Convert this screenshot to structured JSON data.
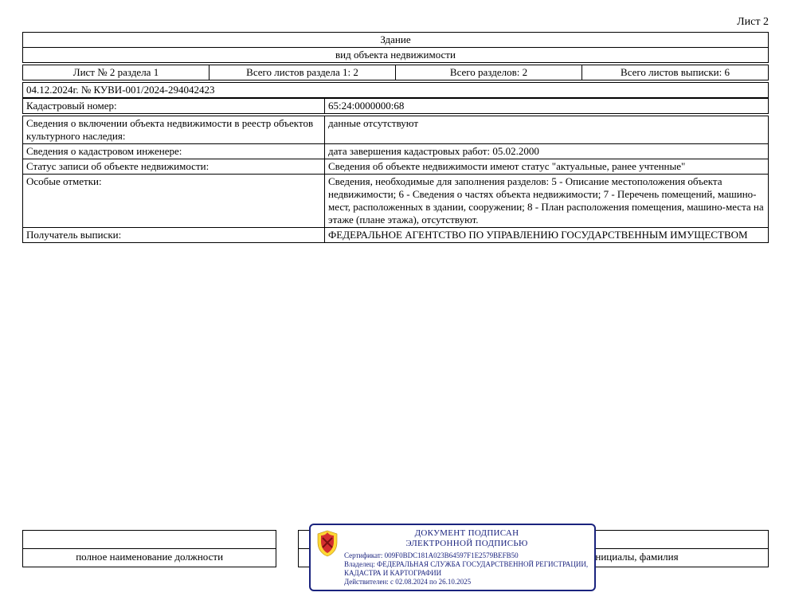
{
  "sheet_label": "Лист 2",
  "header": {
    "object_type": "Здание",
    "object_type_caption": "вид объекта недвижимости"
  },
  "meta": {
    "col1": "Лист № 2 раздела 1",
    "col2": "Всего листов раздела 1: 2",
    "col3": "Всего разделов: 2",
    "col4": "Всего листов выписки: 6"
  },
  "doc_ref": "04.12.2024г. № КУВИ-001/2024-294042423",
  "cad": {
    "label": "Кадастровый номер:",
    "value": "65:24:0000000:68"
  },
  "rows": [
    {
      "label": "Сведения о включении объекта недвижимости в реестр объектов культурного наследия:",
      "value": "данные отсутствуют"
    },
    {
      "label": "Сведения о кадастровом инженере:",
      "value": "дата завершения кадастровых работ: 05.02.2000"
    },
    {
      "label": "Статус записи об объекте недвижимости:",
      "value": "Сведения об объекте недвижимости имеют статус \"актуальные, ранее учтенные\""
    },
    {
      "label": "Особые отметки:",
      "value": "Сведения, необходимые для заполнения разделов: 5 - Описание местоположения объекта недвижимости; 6 - Сведения о частях объекта недвижимости; 7 - Перечень помещений, машино-мест, расположенных в здании, сооружении; 8 - План расположения помещения, машино-места на этаже (плане этажа), отсутствуют."
    },
    {
      "label": "Получатель выписки:",
      "value": "ФЕДЕРАЛЬНОЕ АГЕНТСТВО ПО УПРАВЛЕНИЮ ГОСУДАРСТВЕННЫМ ИМУЩЕСТВОМ"
    }
  ],
  "footer": {
    "position_caption": "полное наименование должности",
    "name_caption": "инициалы, фамилия"
  },
  "stamp": {
    "line1": "ДОКУМЕНТ ПОДПИСАН",
    "line2": "ЭЛЕКТРОННОЙ ПОДПИСЬЮ",
    "cert_label": "Сертификат:",
    "cert_value": "009F0BDC181A023B64597F1E2579BEFB50",
    "owner_label": "Владелец:",
    "owner_value": "ФЕДЕРАЛЬНАЯ СЛУЖБА ГОСУДАРСТВЕННОЙ РЕГИСТРАЦИИ, КАДАСТРА И КАРТОГРАФИИ",
    "valid_label": "Действителен:",
    "valid_value": "с 02.08.2024 по 26.10.2025"
  }
}
